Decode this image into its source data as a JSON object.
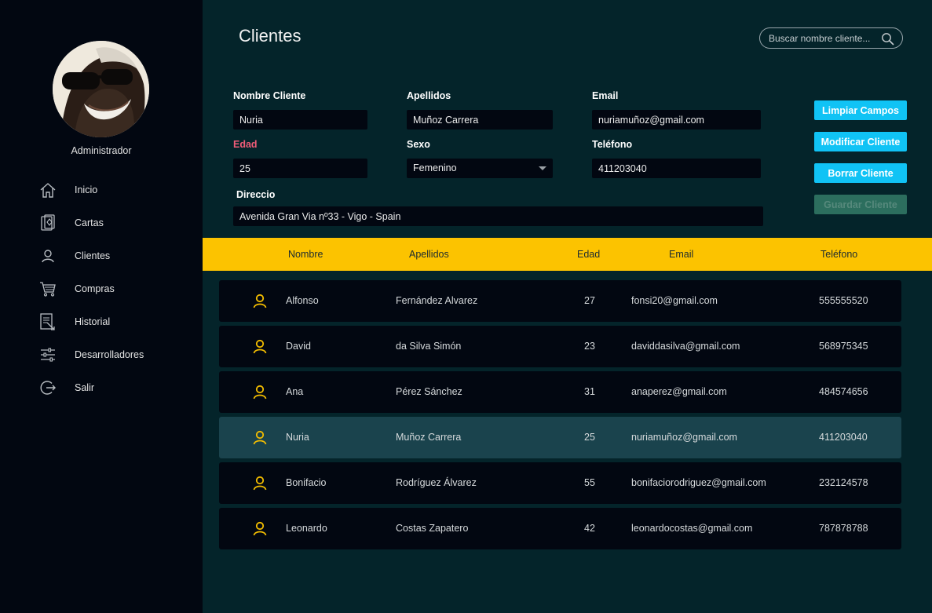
{
  "sidebar": {
    "user_role": "Administrador",
    "items": [
      {
        "label": "Inicio",
        "icon": "home-icon"
      },
      {
        "label": "Cartas",
        "icon": "cards-icon"
      },
      {
        "label": "Clientes",
        "icon": "user-icon"
      },
      {
        "label": "Compras",
        "icon": "cart-icon"
      },
      {
        "label": "Historial",
        "icon": "history-icon"
      },
      {
        "label": "Desarrolladores",
        "icon": "sliders-icon"
      },
      {
        "label": "Salir",
        "icon": "logout-icon"
      }
    ]
  },
  "header": {
    "title": "Clientes",
    "search_placeholder": "Buscar nombre cliente..."
  },
  "form": {
    "nombre": {
      "label": "Nombre Cliente",
      "value": "Nuria"
    },
    "apellidos": {
      "label": "Apellidos",
      "value": "Muñoz Carrera"
    },
    "email": {
      "label": "Email",
      "value": "nuriamuñoz@gmail.com"
    },
    "edad": {
      "label": "Edad",
      "value": "25"
    },
    "sexo": {
      "label": "Sexo",
      "value": "Femenino"
    },
    "telefono": {
      "label": "Teléfono",
      "value": "411203040"
    },
    "direccion": {
      "label": "Direccio",
      "value": "Avenida Gran Via nº33 - Vigo - Spain"
    }
  },
  "actions": {
    "clear": "Limpiar Campos",
    "modify": "Modificar Cliente",
    "delete": "Borrar Cliente",
    "save": "Guardar Cliente"
  },
  "table": {
    "columns": [
      "Nombre",
      "Apellidos",
      "Edad",
      "Email",
      "Teléfono"
    ],
    "rows": [
      {
        "nombre": "Alfonso",
        "apellidos": "Fernández Alvarez",
        "edad": "27",
        "email": "fonsi20@gmail.com",
        "telefono": "555555520"
      },
      {
        "nombre": "David",
        "apellidos": "da Silva Simón",
        "edad": "23",
        "email": "daviddasilva@gmail.com",
        "telefono": "568975345"
      },
      {
        "nombre": "Ana",
        "apellidos": "Pérez Sánchez",
        "edad": "31",
        "email": "anaperez@gmail.com",
        "telefono": "484574656"
      },
      {
        "nombre": "Nuria",
        "apellidos": "Muñoz Carrera",
        "edad": "25",
        "email": "nuriamuñoz@gmail.com",
        "telefono": "411203040"
      },
      {
        "nombre": "Bonifacio",
        "apellidos": "Rodríguez Álvarez",
        "edad": "55",
        "email": "bonifaciorodriguez@gmail.com",
        "telefono": "232124578"
      },
      {
        "nombre": "Leonardo",
        "apellidos": "Costas Zapatero",
        "edad": "42",
        "email": "leonardocostas@gmail.com",
        "telefono": "787878788"
      }
    ],
    "selected_row": 3
  },
  "colors": {
    "sidebar_bg": "#020711",
    "main_bg": "#04242a",
    "header_bar": "#fcc300",
    "accent_button": "#10c3f5",
    "disabled_button": "#2c6e5e",
    "selected_row": "#1a434d",
    "error_label": "#ef5c78"
  }
}
